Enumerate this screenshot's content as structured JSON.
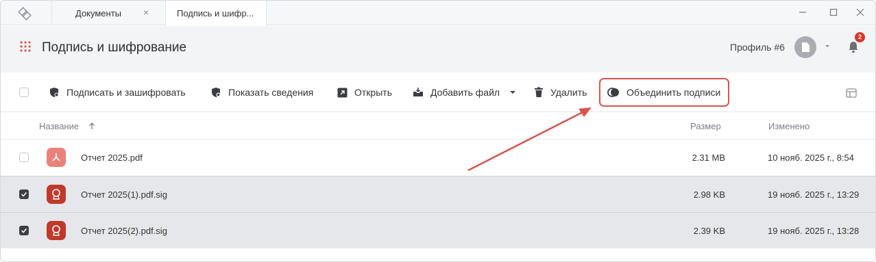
{
  "tabs": [
    {
      "label": "Документы"
    },
    {
      "label": "Подпись и шифр..."
    }
  ],
  "header": {
    "title": "Подпись и шифрование",
    "profile": "Профиль #6",
    "notifications": "2"
  },
  "toolbar": {
    "sign_encrypt": "Подписать и зашифровать",
    "show_info": "Показать сведения",
    "open": "Открыть",
    "add_file": "Добавить файл",
    "delete": "Удалить",
    "merge_signatures": "Объединить подписи"
  },
  "table": {
    "columns": {
      "name": "Название",
      "size": "Размер",
      "modified": "Изменено"
    },
    "rows": [
      {
        "name": "Отчет 2025.pdf",
        "size": "2.31 MB",
        "modified": "10 нояб. 2025 г., 8:54",
        "selected": false
      },
      {
        "name": "Отчет 2025(1).pdf.sig",
        "size": "2.98 KB",
        "modified": "19 нояб. 2025 г., 13:29",
        "selected": true
      },
      {
        "name": "Отчет 2025(2).pdf.sig",
        "size": "2.39 KB",
        "modified": "19 нояб. 2025 г., 13:28",
        "selected": true
      }
    ]
  },
  "colors": {
    "accent_red": "#d9544c",
    "sig_icon": "#c0392b",
    "pdf_icon": "#e9827a"
  },
  "icons": [
    "app-logo-icon",
    "close-icon",
    "minimize-icon",
    "maximize-icon",
    "apps-grid-icon",
    "avatar-icon",
    "chevron-down-icon",
    "bell-icon",
    "shield-sign-icon",
    "shield-info-icon",
    "open-external-icon",
    "add-file-icon",
    "trash-icon",
    "merge-signatures-icon",
    "layout-icon",
    "sort-up-icon",
    "pdf-icon",
    "signature-icon"
  ]
}
